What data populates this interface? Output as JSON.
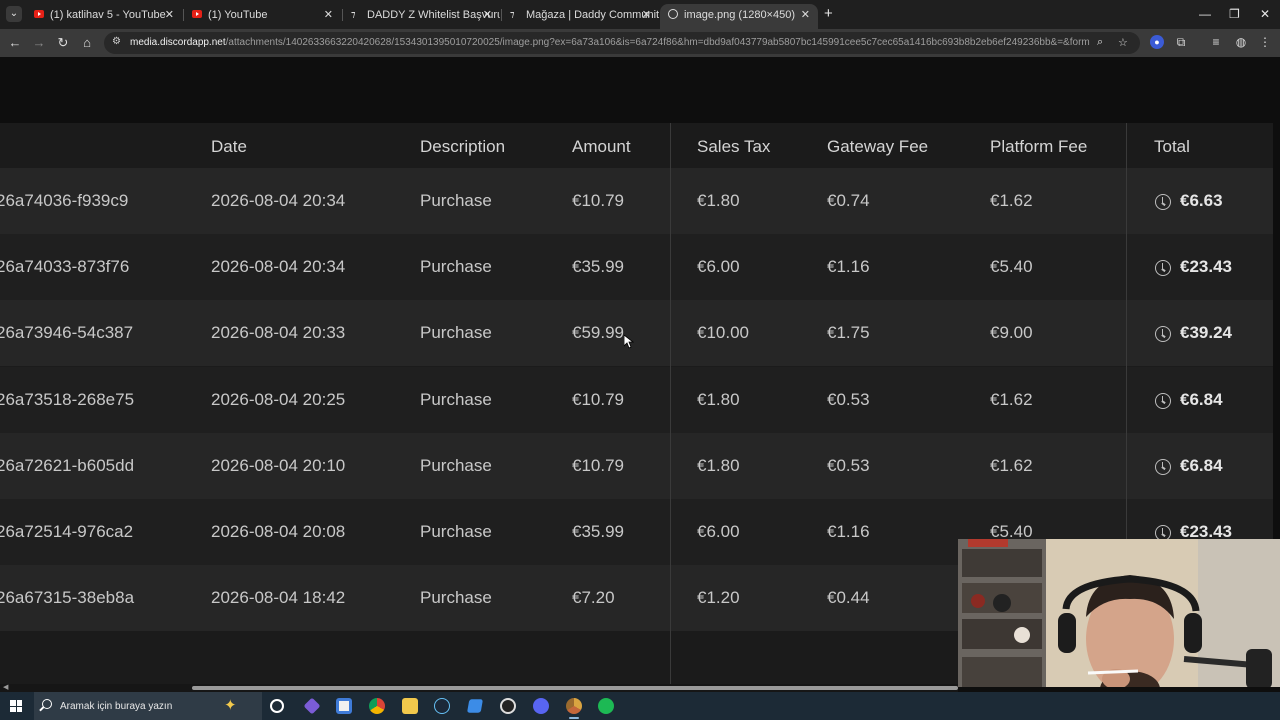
{
  "browser": {
    "tab_menu_icon": "chevron-down-icon",
    "tabs": [
      {
        "title": "(1) katlihav 5 - YouTube",
        "favicon": "youtube-icon"
      },
      {
        "title": "(1) YouTube",
        "favicon": "youtube-icon"
      },
      {
        "title": "DADDY Z Whitelist Başvurusu |",
        "favicon": "daddy-z-icon"
      },
      {
        "title": "Mağaza | Daddy Community",
        "favicon": "daddy-z-icon"
      },
      {
        "title": "image.png (1280×450)",
        "favicon": "globe-icon",
        "active": true
      }
    ],
    "url_host": "media.discordapp.net",
    "url_rest": "/attachments/1402633663220420628/1534301395010720025/image.png?ex=6a73a106&is=6a724f86&hm=dbd9af043779ab5807bc145991cee5c7cec65a1416bc693b8b2eb6ef249236bb&=&format=webp&qua..."
  },
  "table": {
    "headers": [
      "Date",
      "Description",
      "Amount",
      "Sales Tax",
      "Gateway Fee",
      "Platform Fee",
      "Total"
    ],
    "rows": [
      {
        "id": "26a74036-f939c9",
        "date": "2026-08-04 20:34",
        "description": "Purchase",
        "amount": "€10.79",
        "sales_tax": "€1.80",
        "gateway_fee": "€0.74",
        "platform_fee": "€1.62",
        "total": "€6.63"
      },
      {
        "id": "26a74033-873f76",
        "date": "2026-08-04 20:34",
        "description": "Purchase",
        "amount": "€35.99",
        "sales_tax": "€6.00",
        "gateway_fee": "€1.16",
        "platform_fee": "€5.40",
        "total": "€23.43"
      },
      {
        "id": "26a73946-54c387",
        "date": "2026-08-04 20:33",
        "description": "Purchase",
        "amount": "€59.99",
        "sales_tax": "€10.00",
        "gateway_fee": "€1.75",
        "platform_fee": "€9.00",
        "total": "€39.24"
      },
      {
        "id": "26a73518-268e75",
        "date": "2026-08-04 20:25",
        "description": "Purchase",
        "amount": "€10.79",
        "sales_tax": "€1.80",
        "gateway_fee": "€0.53",
        "platform_fee": "€1.62",
        "total": "€6.84"
      },
      {
        "id": "26a72621-b605dd",
        "date": "2026-08-04 20:10",
        "description": "Purchase",
        "amount": "€10.79",
        "sales_tax": "€1.80",
        "gateway_fee": "€0.53",
        "platform_fee": "€1.62",
        "total": "€6.84"
      },
      {
        "id": "26a72514-976ca2",
        "date": "2026-08-04 20:08",
        "description": "Purchase",
        "amount": "€35.99",
        "sales_tax": "€6.00",
        "gateway_fee": "€1.16",
        "platform_fee": "€5.40",
        "total": "€23.43"
      },
      {
        "id": "26a67315-38eb8a",
        "date": "2026-08-04 18:42",
        "description": "Purchase",
        "amount": "€7.20",
        "sales_tax": "€1.20",
        "gateway_fee": "€0.44",
        "platform_fee": "",
        "total": ""
      }
    ]
  },
  "taskbar": {
    "search_placeholder": "Aramak için buraya yazın",
    "pinned": [
      "task-view-icon",
      "obsidian-icon",
      "store-icon",
      "chrome-icon",
      "file-explorer-icon",
      "steam-icon",
      "visual-studio-icon",
      "obs-icon",
      "discord-icon",
      "chrome-canary-icon",
      "spotify-icon"
    ]
  },
  "colors": {
    "page_bg": "#0e0e0e",
    "row_odd": "#262626",
    "row_even": "#1f1f1f",
    "tabstrip": "#1f1f1f",
    "toolbar": "#3a3a3a",
    "taskbar": "#1c2a36"
  }
}
